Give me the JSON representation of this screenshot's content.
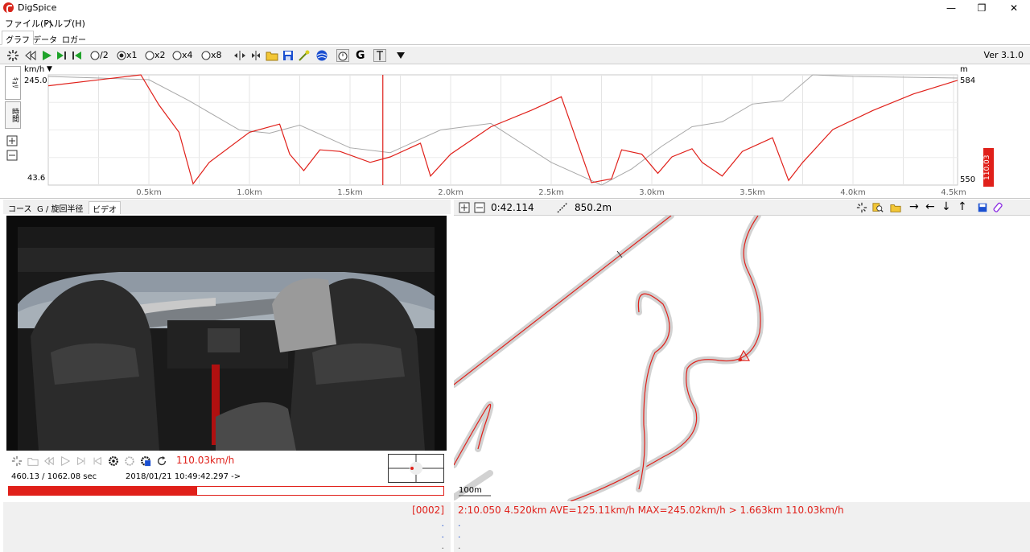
{
  "window": {
    "title": "DigSpice",
    "minimize": "—",
    "restore": "❐",
    "close": "✕"
  },
  "menu": {
    "items": [
      "ファイル(F)",
      "ヘルプ(H)"
    ]
  },
  "tabs": [
    "グラフ",
    "データ",
    "ロガー"
  ],
  "toolbar": {
    "speed_options": [
      "/2",
      "x1",
      "x2",
      "x4",
      "x8"
    ],
    "selected_speed": "x1",
    "version": "Ver 3.1.0",
    "g_label": "G"
  },
  "graph": {
    "vtab_top": "ｷｮﾘ",
    "vtab_bottom": "時間",
    "left_unit": "km/h",
    "right_unit": "m",
    "left_max": "245.0",
    "left_min": "43.6",
    "right_max": "584",
    "right_min": "550",
    "current_value": "110.03",
    "x_ticks": [
      "0.5km",
      "1.0km",
      "1.5km",
      "2.0km",
      "2.5km",
      "3.0km",
      "3.5km",
      "4.0km",
      "4.5km"
    ],
    "colors": {
      "speed": "#e0201a",
      "altitude": "#a8a8a8",
      "cursor": "#e0201a"
    }
  },
  "chart_data": {
    "type": "line",
    "xlim_km": [
      0.0,
      4.52
    ],
    "series": [
      {
        "axis": "left",
        "x": [
          0.0,
          0.46,
          0.55,
          0.65,
          0.72,
          0.8,
          1.0,
          1.15,
          1.2,
          1.27,
          1.35,
          1.45,
          1.6,
          1.7,
          1.85,
          1.9,
          2.0,
          2.2,
          2.4,
          2.55,
          2.7,
          2.8,
          2.85,
          2.95,
          3.03,
          3.1,
          3.2,
          3.25,
          3.35,
          3.45,
          3.6,
          3.68,
          3.75,
          3.9,
          4.1,
          4.3,
          4.52
        ],
        "y": [
          225,
          245,
          190,
          140,
          46,
          85,
          140,
          155,
          100,
          70,
          108,
          105,
          85,
          95,
          120,
          60,
          100,
          150,
          180,
          205,
          48,
          55,
          108,
          100,
          65,
          95,
          110,
          85,
          60,
          105,
          130,
          52,
          85,
          145,
          180,
          210,
          235
        ]
      },
      {
        "axis": "right",
        "x": [
          0.0,
          0.5,
          0.7,
          0.95,
          1.1,
          1.25,
          1.5,
          1.7,
          1.95,
          2.2,
          2.5,
          2.75,
          2.9,
          3.05,
          3.2,
          3.35,
          3.5,
          3.65,
          3.8,
          4.0,
          4.52
        ],
        "y": [
          583.5,
          582.5,
          576,
          567,
          566,
          568.5,
          561.5,
          560,
          567,
          569,
          557,
          550,
          555,
          562,
          568,
          569.5,
          575,
          576,
          584,
          583.5,
          583
        ]
      }
    ],
    "cursor_x_km": 1.663
  },
  "video_panel": {
    "tabs": [
      "コース",
      "G / 旋回半径",
      "ビデオ"
    ],
    "speed_readout": "110.03km/h",
    "time_readout": "460.13 / 1062.08 sec",
    "timestamp": "2018/01/21 10:49:42.297 ->",
    "progress": 0.433
  },
  "map_panel": {
    "lap_time": "0:42.114",
    "distance": "850.2m",
    "scale_label": "100m"
  },
  "status": {
    "left_code": "[0002]",
    "right_text": "2:10.050 4.520km AVE=125.11km/h MAX=245.02km/h > 1.663km 110.03km/h",
    "dots": "."
  }
}
